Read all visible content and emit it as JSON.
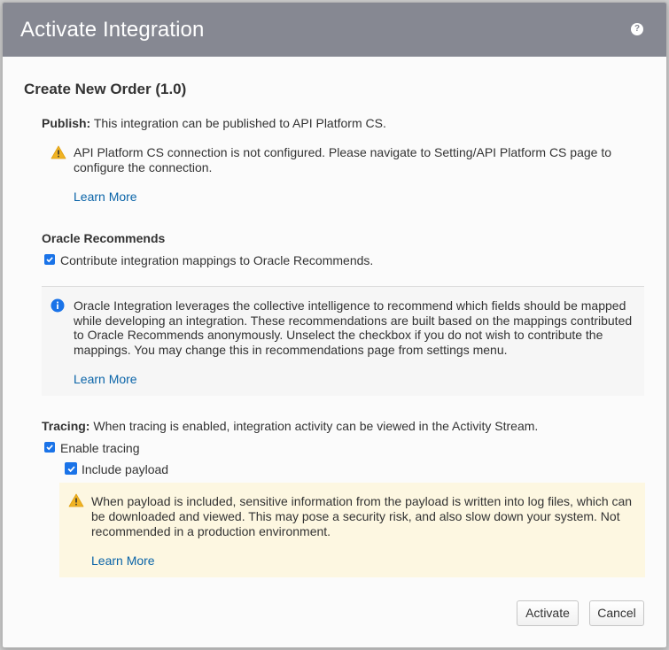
{
  "dialog": {
    "title": "Activate Integration",
    "help_icon_glyph": "?"
  },
  "page_title": "Create New Order (1.0)",
  "publish": {
    "label": "Publish:",
    "text": " This integration can be published to API Platform CS.",
    "warning_line1": "API Platform CS connection is not configured. Please navigate to Setting/API Platform CS page to",
    "warning_line2": "configure the connection.",
    "learn_more": "Learn More"
  },
  "recommends": {
    "heading": "Oracle Recommends",
    "checkbox_label": "Contribute integration mappings to Oracle Recommends.",
    "checked": true,
    "info_line1": "Oracle Integration leverages the collective intelligence to recommend which fields should be mapped",
    "info_line2": "while developing an integration. These recommendations are built based on the mappings contributed",
    "info_line3": "to Oracle Recommends anonymously. Unselect the checkbox if you do not wish to contribute the",
    "info_line4": "mappings. You may change this in recommendations page from settings menu.",
    "learn_more": "Learn More"
  },
  "tracing": {
    "label": "Tracing:",
    "text": " When tracing is enabled, integration activity can be viewed in the Activity Stream.",
    "enable_label": "Enable tracing",
    "enable_checked": true,
    "payload_label": "Include payload",
    "payload_checked": true,
    "warning_line1": "When payload is included, sensitive information from the payload is written into log files, which can",
    "warning_line2": "be downloaded and viewed. This may pose a security risk, and also slow down your system. Not",
    "warning_line3": "recommended in a production environment.",
    "learn_more": "Learn More"
  },
  "buttons": {
    "activate": "Activate",
    "cancel": "Cancel"
  },
  "icons": {
    "warning": "warning-icon",
    "info": "info-icon",
    "help": "help-icon",
    "check": "check-icon"
  },
  "colors": {
    "titlebar": "#868892",
    "link": "#0a64a8",
    "checkbox": "#1a73e8",
    "warning_bg": "#fdf7e1",
    "warning_icon": "#f0b323",
    "info_icon": "#1a73e8"
  }
}
